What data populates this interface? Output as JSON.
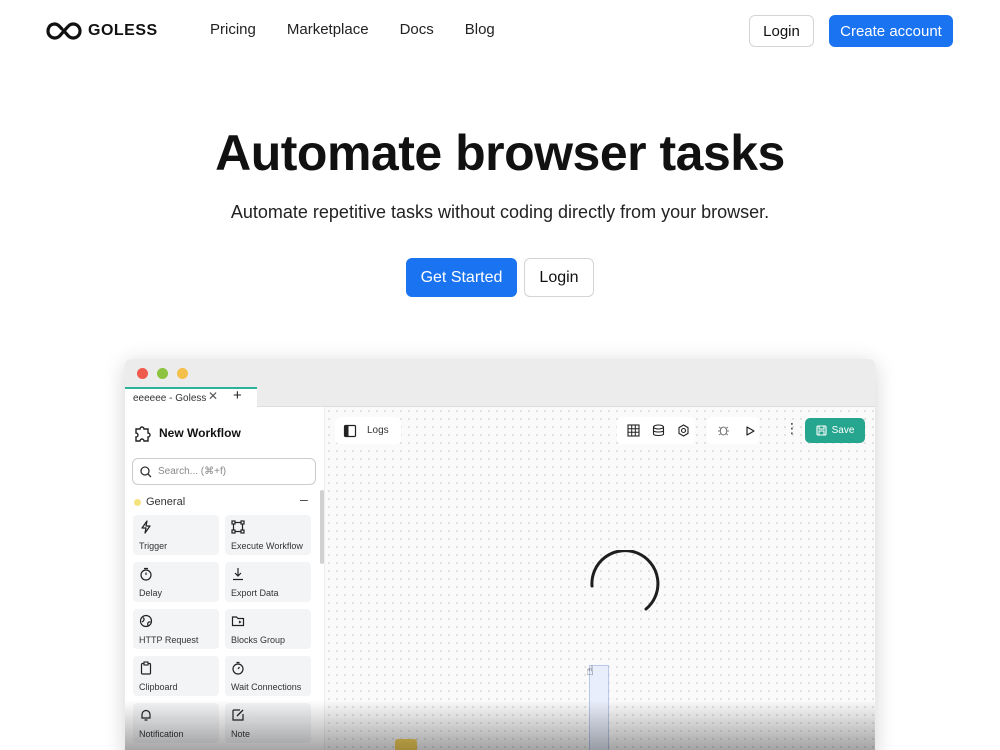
{
  "brand": {
    "name": "GOLESS"
  },
  "nav": {
    "links": [
      "Pricing",
      "Marketplace",
      "Docs",
      "Blog"
    ],
    "login": "Login",
    "create_account": "Create account"
  },
  "hero": {
    "title": "Automate browser tasks",
    "subtitle": "Automate repetitive tasks without coding directly from your browser.",
    "cta_primary": "Get Started",
    "cta_secondary": "Login"
  },
  "app": {
    "tab_title": "eeeeee - Goless",
    "sidebar_title": "New Workflow",
    "search_placeholder": "Search... (⌘+f)",
    "category": "General",
    "blocks": [
      {
        "label": "Trigger",
        "icon": "lightning-icon"
      },
      {
        "label": "Execute Workflow",
        "icon": "workflow-icon"
      },
      {
        "label": "Delay",
        "icon": "timer-icon"
      },
      {
        "label": "Export Data",
        "icon": "download-icon"
      },
      {
        "label": "HTTP Request",
        "icon": "globe-icon"
      },
      {
        "label": "Blocks Group",
        "icon": "folder-icon"
      },
      {
        "label": "Clipboard",
        "icon": "clipboard-icon"
      },
      {
        "label": "Wait Connections",
        "icon": "stopwatch-icon"
      },
      {
        "label": "Notification",
        "icon": "bell-icon"
      },
      {
        "label": "Note",
        "icon": "note-icon"
      }
    ],
    "logs_label": "Logs",
    "save_label": "Save"
  },
  "colors": {
    "primary": "#1a73f0",
    "accent_green": "#26a68e",
    "traffic_red": "#f05a4d",
    "traffic_green": "#8cc43f",
    "traffic_yellow": "#f5c04a"
  }
}
